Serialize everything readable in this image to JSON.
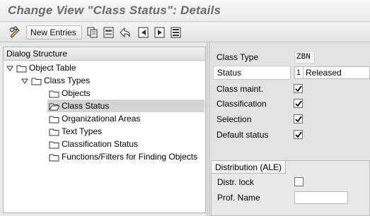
{
  "title": "Change View \"Class Status\": Details",
  "toolbar": {
    "new_entries_label": "New Entries",
    "icons": [
      "edit-glasses-icon",
      "copy-icon",
      "delete-icon",
      "undo-icon",
      "previous-entry-icon",
      "next-entry-icon",
      "select-all-icon"
    ]
  },
  "dialog_structure": {
    "header": "Dialog Structure",
    "items": [
      {
        "label": "Object Table",
        "level": 0,
        "expanded": true
      },
      {
        "label": "Class Types",
        "level": 1,
        "expanded": true
      },
      {
        "label": "Objects",
        "level": 2
      },
      {
        "label": "Class Status",
        "level": 2,
        "selected": true,
        "open": true
      },
      {
        "label": "Organizational Areas",
        "level": 2
      },
      {
        "label": "Text Types",
        "level": 2
      },
      {
        "label": "Classification Status",
        "level": 2
      },
      {
        "label": "Functions/Filters for Finding Objects",
        "level": 2
      }
    ]
  },
  "details": {
    "class_type": {
      "label": "Class Type",
      "value": "ZBN"
    },
    "status": {
      "label": "Status",
      "code": "1",
      "text": "Released"
    },
    "class_maint": {
      "label": "Class maint.",
      "checked": true
    },
    "classification": {
      "label": "Classification",
      "checked": true
    },
    "selection": {
      "label": "Selection",
      "checked": true
    },
    "default_status": {
      "label": "Default status",
      "checked": true
    }
  },
  "distribution": {
    "tab_label": "Distribution (ALE)",
    "distr_lock": {
      "label": "Distr. lock",
      "checked": false
    },
    "prof_name": {
      "label": "Prof. Name",
      "value": ""
    }
  },
  "colors": {
    "title_text": "#6a6a6a",
    "selected_row": "#d4d4d4",
    "panel_bg": "#e3e3e3"
  }
}
